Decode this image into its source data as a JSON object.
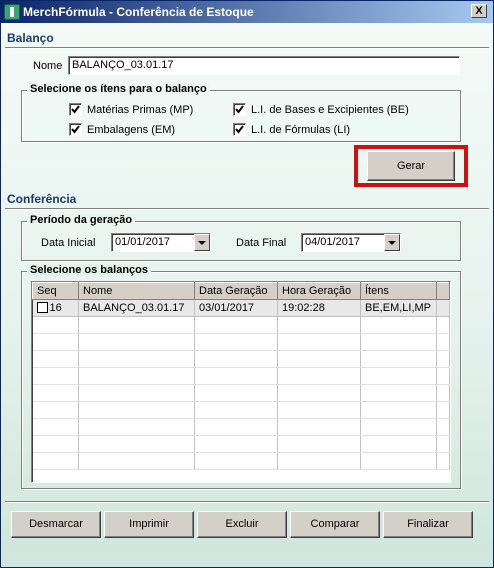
{
  "window": {
    "title": "MerchFórmula - Conferência de Estoque",
    "close_label": "X"
  },
  "balanco": {
    "section_title": "Balanço",
    "nome_label": "Nome",
    "nome_value": "BALANÇO_03.01.17",
    "group_title": "Selecione os ítens para o balanço",
    "checkboxes": [
      {
        "label": "Matérias Primas (MP)",
        "checked": true
      },
      {
        "label": "Embalagens (EM)",
        "checked": true
      },
      {
        "label": "L.I. de Bases e Excipientes (BE)",
        "checked": true
      },
      {
        "label": "L.I. de Fórmulas (LI)",
        "checked": true
      }
    ],
    "gerar_label": "Gerar"
  },
  "conferencia": {
    "section_title": "Conferência",
    "periodo_title": "Período da geração",
    "data_inicial_label": "Data Inicial",
    "data_inicial_value": "01/01/2017",
    "data_final_label": "Data Final",
    "data_final_value": "04/01/2017",
    "balancos_title": "Selecione os balanços",
    "columns": [
      "Seq",
      "Nome",
      "Data Geração",
      "Hora Geração",
      "Ítens"
    ],
    "rows": [
      {
        "seq": "16",
        "nome": "BALANÇO_03.01.17",
        "data": "03/01/2017",
        "hora": "19:02:28",
        "itens": "BE,EM,LI,MP",
        "checked": false
      }
    ]
  },
  "buttons": {
    "desmarcar": "Desmarcar",
    "imprimir": "Imprimir",
    "excluir": "Excluir",
    "comparar": "Comparar",
    "finalizar": "Finalizar"
  },
  "colors": {
    "highlight": "#d01010",
    "title_bar_start": "#0a246a",
    "title_bar_end": "#a6caf0"
  }
}
